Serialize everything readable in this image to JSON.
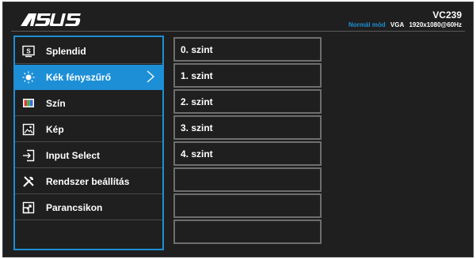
{
  "header": {
    "brand": "ASUS",
    "model": "VC239",
    "mode": "Normál mód",
    "signal": "VGA",
    "resolution": "1920x1080@60Hz"
  },
  "menu": {
    "items": [
      {
        "label": "Splendid",
        "icon": "splendid-icon"
      },
      {
        "label": "Kék fényszűrő",
        "icon": "blue-light-icon",
        "selected": true
      },
      {
        "label": "Szín",
        "icon": "color-icon"
      },
      {
        "label": "Kép",
        "icon": "image-icon"
      },
      {
        "label": "Input Select",
        "icon": "input-select-icon"
      },
      {
        "label": "Rendszer beállítás",
        "icon": "system-setup-icon"
      },
      {
        "label": "Parancsikon",
        "icon": "shortcut-icon"
      }
    ]
  },
  "submenu": {
    "items": [
      "0. szint",
      "1. szint",
      "2. szint",
      "3. szint",
      "4. szint",
      "",
      "",
      ""
    ]
  },
  "colors": {
    "accent": "#1c8fd6",
    "background": "#1f1f1f",
    "border": "#6e6e6e"
  }
}
